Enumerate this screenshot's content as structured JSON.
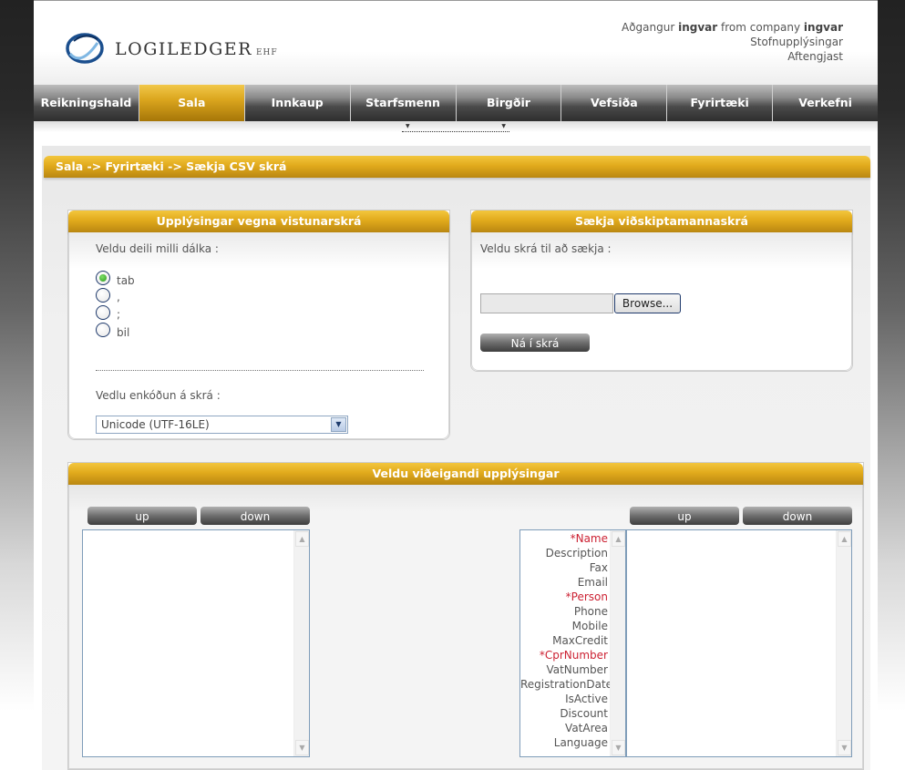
{
  "header": {
    "brand": "LOGILEDGER",
    "brand_suffix": "EHF",
    "access_prefix": "Aðgangur",
    "user": "ingvar",
    "company_prefix": "from company",
    "company": "ingvar",
    "link_basic_info": "Stofnupplýsingar",
    "link_logout": "Aftengjast"
  },
  "nav": [
    {
      "label": "Reikningshald"
    },
    {
      "label": "Sala"
    },
    {
      "label": "Innkaup"
    },
    {
      "label": "Starfsmenn"
    },
    {
      "label": "Birgðir"
    },
    {
      "label": "Vefsiða"
    },
    {
      "label": "Fyrirtæki"
    },
    {
      "label": "Verkefni"
    }
  ],
  "breadcrumb": "Sala -> Fyrirtæki -> Sækja CSV skrá",
  "file_panel": {
    "title": "Upplýsingar vegna vistunarskrá",
    "delimiter_label": "Veldu deili milli dálka :",
    "delimiters": [
      "tab",
      ",",
      ";",
      "bil"
    ],
    "selected_delimiter": "tab",
    "encoding_label": "Vedlu enkóðun á skrá :",
    "encoding_value": "Unicode (UTF-16LE)"
  },
  "upload_panel": {
    "title": "Sækja viðskiptamannaskrá",
    "choose_label": "Veldu skrá til að sækja :",
    "browse_label": "Browse...",
    "fetch_label": "Ná í skrá"
  },
  "select_panel": {
    "title": "Veldu viðeigandi upplýsingar",
    "up_label": "up",
    "down_label": "down",
    "fields": [
      "*Name",
      "Description",
      "Fax",
      "Email",
      "*Person",
      "Phone",
      "Mobile",
      "MaxCredit",
      "*CprNumber",
      "VatNumber",
      "RegistrationDate",
      "IsActive",
      "Discount",
      "VatArea",
      "Language"
    ]
  },
  "colors": {
    "gold": "#e1aa1c",
    "nav_dark": "#2e2e2e",
    "radio_checked": "#2c9b1d"
  }
}
